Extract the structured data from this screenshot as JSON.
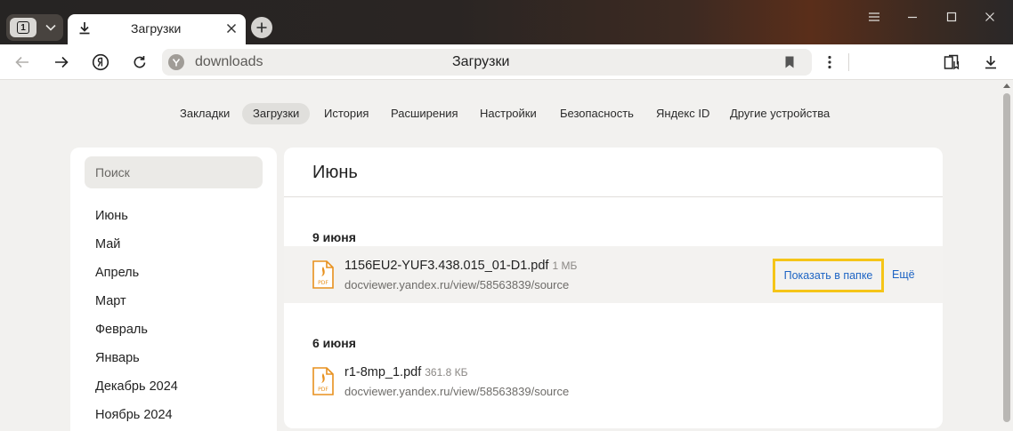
{
  "tabs": {
    "count": "1",
    "active_title": "Загрузки"
  },
  "toolbar": {
    "url": "downloads",
    "page_title": "Загрузки"
  },
  "nav": {
    "items": [
      {
        "label": "Закладки",
        "active": false
      },
      {
        "label": "Загрузки",
        "active": true
      },
      {
        "label": "История",
        "active": false
      },
      {
        "label": "Расширения",
        "active": false
      },
      {
        "label": "Настройки",
        "active": false
      },
      {
        "label": "Безопасность",
        "active": false
      },
      {
        "label": "Яндекс ID",
        "active": false
      },
      {
        "label": "Другие устройства",
        "active": false
      }
    ]
  },
  "sidebar": {
    "search_placeholder": "Поиск",
    "months": [
      "Июнь",
      "Май",
      "Апрель",
      "Март",
      "Февраль",
      "Январь",
      "Декабрь 2024",
      "Ноябрь 2024"
    ]
  },
  "main": {
    "title": "Июнь",
    "groups": [
      {
        "date": "9 июня",
        "items": [
          {
            "name": "1156EU2-YUF3.438.015_01-D1.pdf",
            "size": "1 МБ",
            "url": "docviewer.yandex.ru/view/58563839/source",
            "show_folder_label": "Показать в папке",
            "more_label": "Ещё"
          }
        ]
      },
      {
        "date": "6 июня",
        "items": [
          {
            "name": "r1-8mp_1.pdf",
            "size": "361.8 КБ",
            "url": "docviewer.yandex.ru/view/58563839/source"
          }
        ]
      }
    ]
  },
  "file_icon_label": "PDF",
  "colors": {
    "accent_link": "#1d64c4",
    "highlight_border": "#f5c518",
    "pdf_icon": "#e8911e"
  }
}
